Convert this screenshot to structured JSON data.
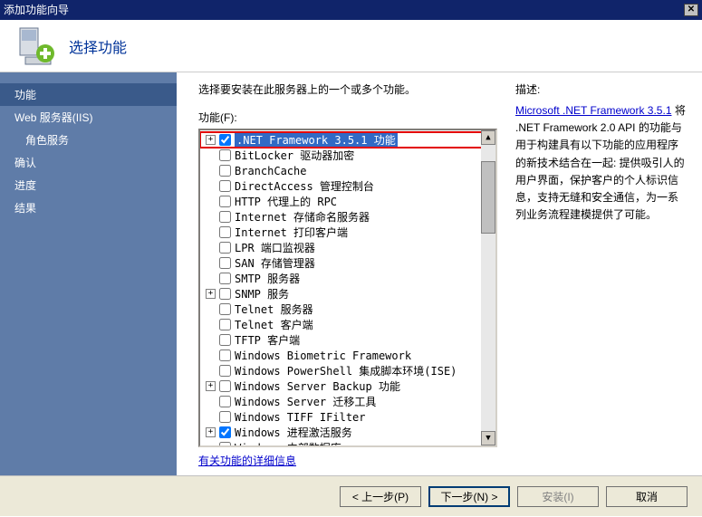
{
  "window": {
    "title": "添加功能向导"
  },
  "header": {
    "title": "选择功能"
  },
  "sidebar": {
    "items": [
      {
        "label": "功能",
        "active": true,
        "sub": false
      },
      {
        "label": "Web 服务器(IIS)",
        "active": false,
        "sub": false
      },
      {
        "label": "角色服务",
        "active": false,
        "sub": true
      },
      {
        "label": "确认",
        "active": false,
        "sub": false
      },
      {
        "label": "进度",
        "active": false,
        "sub": false
      },
      {
        "label": "结果",
        "active": false,
        "sub": false
      }
    ]
  },
  "main": {
    "intro": "选择要安装在此服务器上的一个或多个功能。",
    "features_label": "功能(F):",
    "more_link": "有关功能的详细信息",
    "tree": [
      {
        "expand": "+",
        "checked": true,
        "label": ".NET Framework 3.5.1 功能",
        "selected": true,
        "highlight": true
      },
      {
        "expand": "",
        "checked": false,
        "label": "BitLocker 驱动器加密"
      },
      {
        "expand": "",
        "checked": false,
        "label": "BranchCache"
      },
      {
        "expand": "",
        "checked": false,
        "label": "DirectAccess 管理控制台"
      },
      {
        "expand": "",
        "checked": false,
        "label": "HTTP 代理上的 RPC"
      },
      {
        "expand": "",
        "checked": false,
        "label": "Internet 存储命名服务器"
      },
      {
        "expand": "",
        "checked": false,
        "label": "Internet 打印客户端"
      },
      {
        "expand": "",
        "checked": false,
        "label": "LPR 端口监视器"
      },
      {
        "expand": "",
        "checked": false,
        "label": "SAN 存储管理器"
      },
      {
        "expand": "",
        "checked": false,
        "label": "SMTP 服务器"
      },
      {
        "expand": "+",
        "checked": false,
        "label": "SNMP 服务"
      },
      {
        "expand": "",
        "checked": false,
        "label": "Telnet 服务器"
      },
      {
        "expand": "",
        "checked": false,
        "label": "Telnet 客户端"
      },
      {
        "expand": "",
        "checked": false,
        "label": "TFTP 客户端"
      },
      {
        "expand": "",
        "checked": false,
        "label": "Windows Biometric Framework"
      },
      {
        "expand": "",
        "checked": false,
        "label": "Windows PowerShell 集成脚本环境(ISE)"
      },
      {
        "expand": "+",
        "checked": false,
        "label": "Windows Server Backup 功能"
      },
      {
        "expand": "",
        "checked": false,
        "label": "Windows Server 迁移工具"
      },
      {
        "expand": "",
        "checked": false,
        "label": "Windows TIFF IFilter"
      },
      {
        "expand": "+",
        "checked": true,
        "label": "Windows 进程激活服务"
      },
      {
        "expand": "",
        "checked": false,
        "label": "Windows 内部数据库"
      }
    ]
  },
  "description": {
    "label": "描述:",
    "link": "Microsoft .NET Framework 3.5.1",
    "body": "将 .NET Framework 2.0 API 的功能与用于构建具有以下功能的应用程序的新技术结合在一起: 提供吸引人的用户界面，保护客户的个人标识信息，支持无缝和安全通信，为一系列业务流程建模提供了可能。"
  },
  "footer": {
    "prev": "< 上一步(P)",
    "next": "下一步(N) >",
    "install": "安装(I)",
    "cancel": "取消"
  }
}
